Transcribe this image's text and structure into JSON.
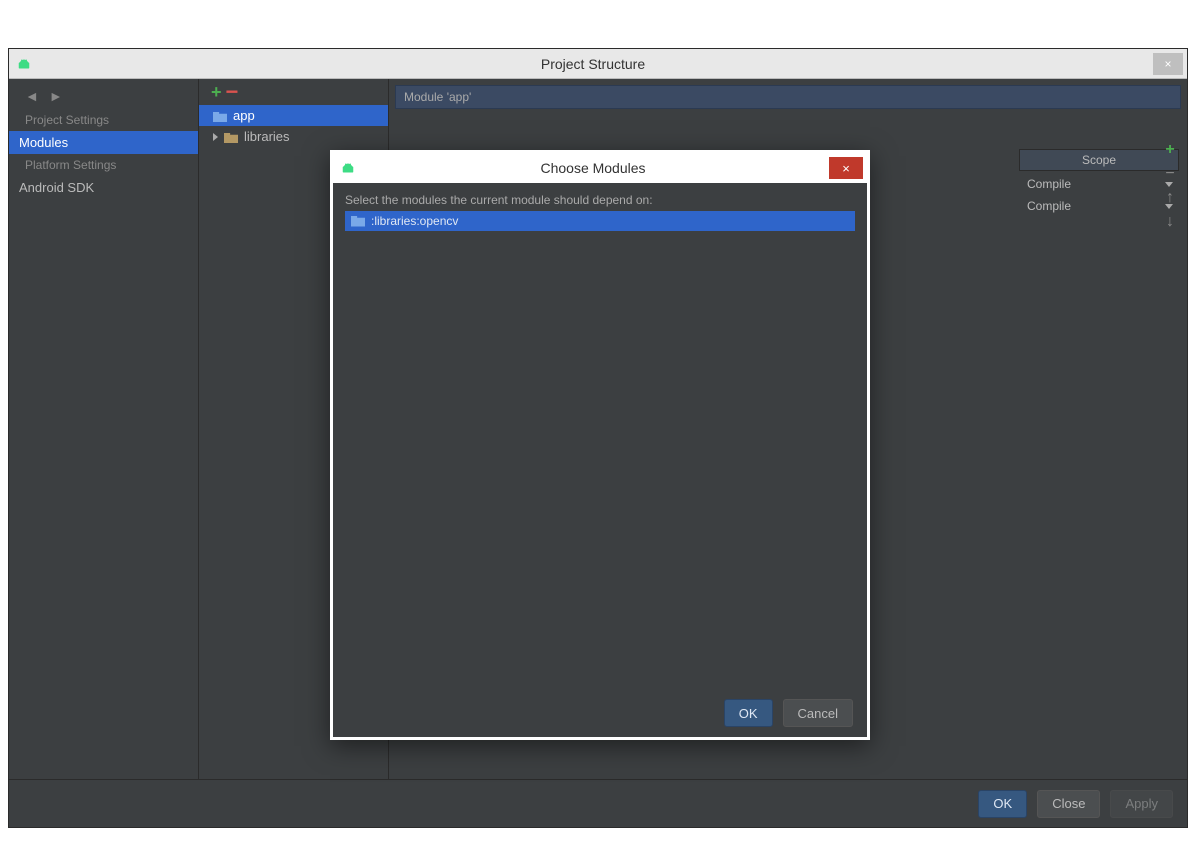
{
  "outer_window": {
    "title": "Project Structure",
    "close_glyph": "×"
  },
  "sidebar": {
    "section1_header": "Project Settings",
    "modules_label": "Modules",
    "section2_header": "Platform Settings",
    "android_sdk_label": "Android SDK"
  },
  "modules_panel": {
    "items": [
      {
        "label": "app",
        "selected": true,
        "expandable": false
      },
      {
        "label": "libraries",
        "selected": false,
        "expandable": true
      }
    ]
  },
  "main_panel": {
    "breadcrumb": "Module 'app'",
    "scope_header": "Scope",
    "scope_rows": [
      {
        "label": "Compile"
      },
      {
        "label": "Compile"
      }
    ]
  },
  "bottom_buttons": {
    "ok": "OK",
    "close": "Close",
    "apply": "Apply"
  },
  "modal": {
    "title": "Choose Modules",
    "close_glyph": "×",
    "instruction": "Select the modules the current module should depend on:",
    "items": [
      {
        "label": ":libraries:opencv",
        "selected": true
      }
    ],
    "ok": "OK",
    "cancel": "Cancel"
  }
}
